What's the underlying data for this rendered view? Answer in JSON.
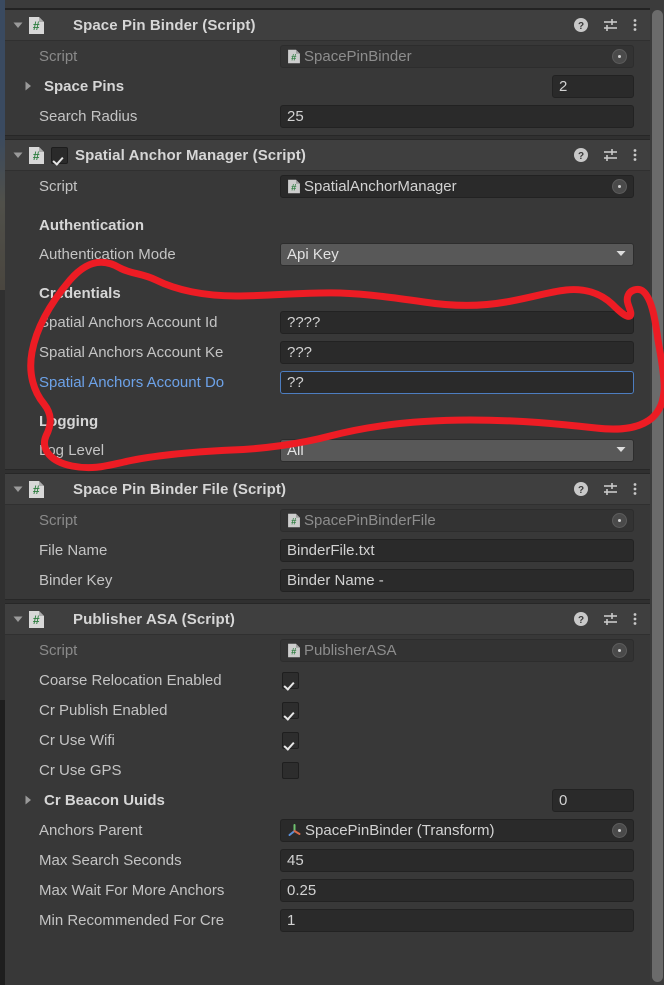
{
  "app": {
    "panel": "Unity Inspector"
  },
  "header_icons": {
    "help": "help-icon",
    "preset": "preset-settings-icon",
    "menu": "more-options-icon"
  },
  "colors": {
    "panel_bg": "#383838",
    "header_bg": "#3f3f3f",
    "field_bg": "#2a2a2a",
    "dropdown_bg": "#585858",
    "label": "#c4c4c4",
    "label_modified": "#6da2e8",
    "focus_border": "#4d7dc0",
    "annotation": "#ed1c24",
    "script_icon_green": "#2d7d3f"
  },
  "components": [
    {
      "title": "Space Pin Binder (Script)",
      "icon": "csharp-script-icon",
      "expanded": true,
      "has_enable_toggle": false,
      "rows": [
        {
          "kind": "objref",
          "label": "Script",
          "value": "SpacePinBinder",
          "disabled": true,
          "icon": "csharp-script-icon"
        },
        {
          "kind": "array",
          "label": "Space Pins",
          "count": "2",
          "expanded": false
        },
        {
          "kind": "text",
          "label": "Search Radius",
          "value": "25"
        }
      ]
    },
    {
      "title": "Spatial Anchor Manager (Script)",
      "icon": "csharp-script-icon",
      "expanded": true,
      "has_enable_toggle": true,
      "enabled": true,
      "rows": [
        {
          "kind": "objref",
          "label": "Script",
          "value": "SpatialAnchorManager",
          "disabled": false,
          "icon": "csharp-script-icon"
        },
        {
          "kind": "spacer"
        },
        {
          "kind": "section",
          "label": "Authentication"
        },
        {
          "kind": "dropdown",
          "label": "Authentication Mode",
          "value": "Api Key"
        },
        {
          "kind": "spacer"
        },
        {
          "kind": "section",
          "label": "Credentials"
        },
        {
          "kind": "text",
          "label": "Spatial Anchors Account Id",
          "value": "????"
        },
        {
          "kind": "text",
          "label": "Spatial Anchors Account Ke",
          "value": "???"
        },
        {
          "kind": "text",
          "label": "Spatial Anchors Account Do",
          "value": "??",
          "modified": true,
          "focused": true
        },
        {
          "kind": "spacer"
        },
        {
          "kind": "section",
          "label": "Logging"
        },
        {
          "kind": "dropdown",
          "label": "Log Level",
          "value": "All"
        }
      ]
    },
    {
      "title": "Space Pin Binder File (Script)",
      "icon": "csharp-script-icon",
      "expanded": true,
      "has_enable_toggle": false,
      "rows": [
        {
          "kind": "objref",
          "label": "Script",
          "value": "SpacePinBinderFile",
          "disabled": true,
          "icon": "csharp-script-icon"
        },
        {
          "kind": "text",
          "label": "File Name",
          "value": "BinderFile.txt"
        },
        {
          "kind": "text",
          "label": "Binder Key",
          "value": "Binder Name -"
        }
      ]
    },
    {
      "title": "Publisher ASA (Script)",
      "icon": "csharp-script-icon",
      "expanded": true,
      "has_enable_toggle": false,
      "rows": [
        {
          "kind": "objref",
          "label": "Script",
          "value": "PublisherASA",
          "disabled": true,
          "icon": "csharp-script-icon"
        },
        {
          "kind": "checkbox",
          "label": "Coarse Relocation Enabled",
          "checked": true
        },
        {
          "kind": "checkbox",
          "label": "Cr Publish Enabled",
          "checked": true
        },
        {
          "kind": "checkbox",
          "label": "Cr Use Wifi",
          "checked": true
        },
        {
          "kind": "checkbox",
          "label": "Cr Use GPS",
          "checked": false
        },
        {
          "kind": "array",
          "label": "Cr Beacon Uuids",
          "count": "0",
          "expanded": false
        },
        {
          "kind": "objref",
          "label": "Anchors Parent",
          "value": "SpacePinBinder (Transform)",
          "disabled": false,
          "icon": "transform-gizmo-icon"
        },
        {
          "kind": "text",
          "label": "Max Search Seconds",
          "value": "45"
        },
        {
          "kind": "text",
          "label": "Max Wait For More Anchors",
          "value": "0.25"
        },
        {
          "kind": "text",
          "label": "Min Recommended For Cre",
          "value": "1"
        }
      ]
    }
  ],
  "annotation": {
    "type": "freehand-ellipse",
    "color": "#ed1c24",
    "stroke_width": 7,
    "encircles": "Credentials group: Spatial Anchors Account Id / Key / Domain fields"
  }
}
